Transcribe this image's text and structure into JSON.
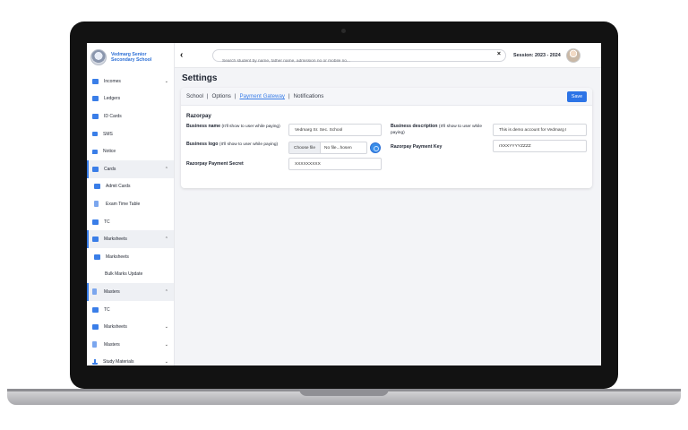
{
  "school": {
    "name": "Vedmarg Senior Secondary School"
  },
  "sidebar": {
    "items": [
      {
        "label": "Incomes",
        "chevron": "⌄"
      },
      {
        "label": "Ledgers"
      },
      {
        "label": "ID Cards"
      },
      {
        "label": "SMS"
      },
      {
        "label": "Notice"
      },
      {
        "label": "Cards",
        "chevron": "⌃"
      },
      {
        "label": "Admit Cards"
      },
      {
        "label": "Exam Time Table"
      },
      {
        "label": "TC"
      },
      {
        "label": "Marksheets",
        "chevron": "⌃"
      },
      {
        "label": "Marksheets"
      },
      {
        "label": "Bulk Marks Update"
      },
      {
        "label": "Masters",
        "chevron": "⌃"
      },
      {
        "label": "TC"
      },
      {
        "label": "Marksheets",
        "chevron": "⌄"
      },
      {
        "label": "Masters",
        "chevron": "⌄"
      },
      {
        "label": "Study Materials",
        "chevron": "⌄"
      }
    ]
  },
  "topbar": {
    "back": "‹",
    "search_placeholder": "Search student by name, father name, admission no or mobile no...",
    "clear": "×",
    "session": "Session: 2023 - 2024"
  },
  "page": {
    "title": "Settings"
  },
  "tabs": {
    "items": [
      "School",
      "Options",
      "Payment Gateway",
      "Notifications"
    ],
    "separator": "|",
    "active": "Payment Gateway"
  },
  "actions": {
    "save": "Save"
  },
  "razorpay": {
    "section_title": "Razorpay",
    "business_name_label": "Business name",
    "business_name_note": "(It'll show to user while paying)",
    "business_name_value": "Vedmarg Sr. Sec. School",
    "business_description_label": "Business description",
    "business_description_note": "(It'll show to user while paying)",
    "business_description_value": "This is demo account for Vedmarg I",
    "business_logo_label": "Business logo",
    "business_logo_note": "(It'll show to user while paying)",
    "choose_file": "Choose file",
    "file_name": "No file...hosen",
    "payment_key_label": "Razorpay Payment Key",
    "payment_key_value": "rXXXYYYYZZZZ",
    "payment_secret_label": "Razorpay Payment Secret",
    "payment_secret_value": "XXXXXXXXX"
  },
  "colors": {
    "accent": "#2d74e6",
    "sidebar_active": "#eef0f4",
    "page_bg": "#f3f4f7"
  }
}
